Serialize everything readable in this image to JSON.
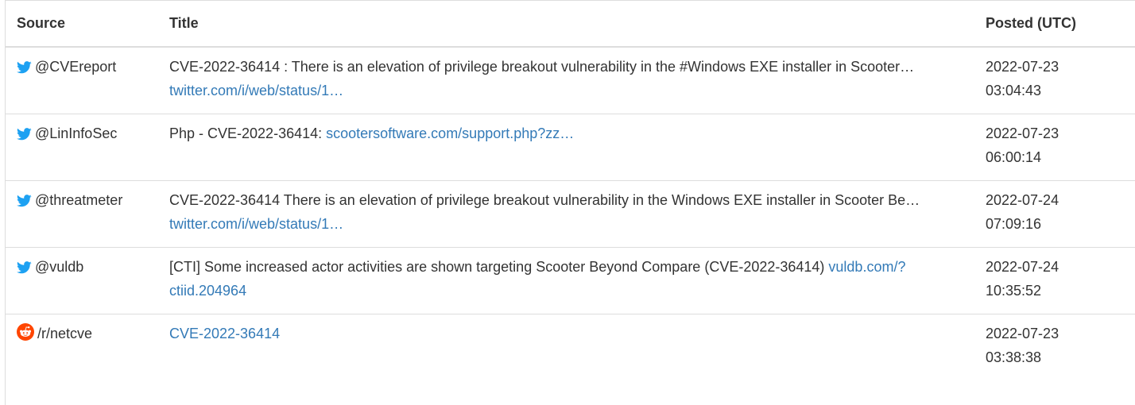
{
  "headers": {
    "source": "Source",
    "title": "Title",
    "posted": "Posted (UTC)"
  },
  "colors": {
    "link": "#337ab7",
    "twitter": "#1da1f2",
    "reddit": "#ff4500",
    "border": "#dddddd",
    "text": "#333333"
  },
  "rows": [
    {
      "icon": "twitter-icon",
      "source": "@CVEreport",
      "title_text": "CVE-2022-36414 : There is an elevation of privilege breakout vulnerability in the #Windows EXE installer in Scooter… ",
      "link_text": "twitter.com/i/web/status/1…",
      "date": "2022-07-23",
      "time": "03:04:43"
    },
    {
      "icon": "twitter-icon",
      "source": "@LinInfoSec",
      "title_text": "Php - CVE-2022-36414: ",
      "link_text": "scootersoftware.com/support.php?zz…",
      "date": "2022-07-23",
      "time": "06:00:14"
    },
    {
      "icon": "twitter-icon",
      "source": "@threatmeter",
      "title_text": "CVE-2022-36414 There is an elevation of privilege breakout vulnerability in the Windows EXE installer in Scooter Be… ",
      "link_text": "twitter.com/i/web/status/1…",
      "date": "2022-07-24",
      "time": "07:09:16"
    },
    {
      "icon": "twitter-icon",
      "source": "@vuldb",
      "title_text": "[CTI] Some increased actor activities are shown targeting Scooter Beyond Compare (CVE-2022-36414) ",
      "link_text": "vuldb.com/?ctiid.204964",
      "date": "2022-07-24",
      "time": "10:35:52"
    },
    {
      "icon": "reddit-icon",
      "source": "/r/netcve",
      "title_text": "",
      "link_text": "CVE-2022-36414",
      "date": "2022-07-23",
      "time": "03:38:38"
    }
  ]
}
